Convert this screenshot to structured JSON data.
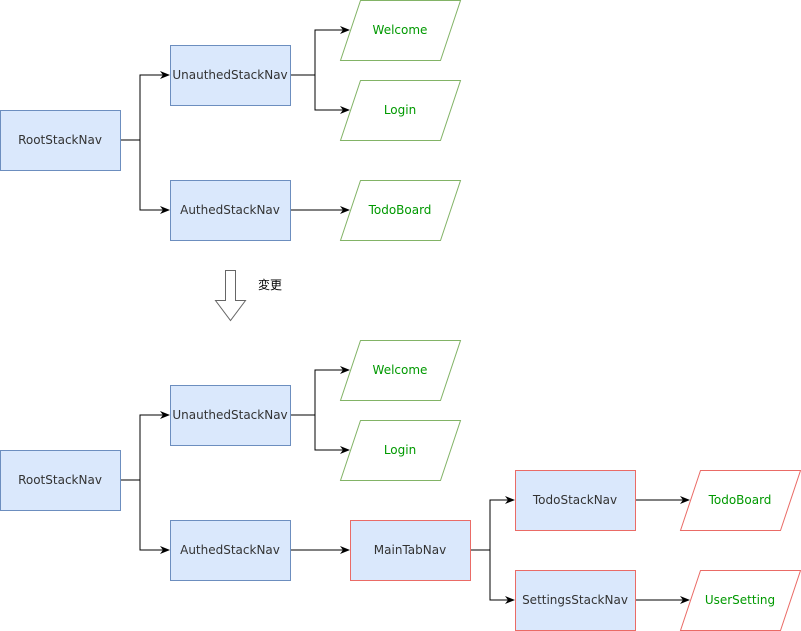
{
  "diagram": {
    "before": {
      "nodes": {
        "root": "RootStackNav",
        "unauthed": "UnauthedStackNav",
        "authed": "AuthedStackNav",
        "welcome": "Welcome",
        "login": "Login",
        "todoboard": "TodoBoard"
      },
      "edges": [
        [
          "RootStackNav",
          "UnauthedStackNav"
        ],
        [
          "RootStackNav",
          "AuthedStackNav"
        ],
        [
          "UnauthedStackNav",
          "Welcome"
        ],
        [
          "UnauthedStackNav",
          "Login"
        ],
        [
          "AuthedStackNav",
          "TodoBoard"
        ]
      ]
    },
    "transition_label": "変更",
    "after": {
      "nodes": {
        "root": "RootStackNav",
        "unauthed": "UnauthedStackNav",
        "authed": "AuthedStackNav",
        "welcome": "Welcome",
        "login": "Login",
        "maintab": "MainTabNav",
        "todostack": "TodoStackNav",
        "settingsstack": "SettingsStackNav",
        "todoboard": "TodoBoard",
        "usersetting": "UserSetting"
      },
      "edges": [
        [
          "RootStackNav",
          "UnauthedStackNav"
        ],
        [
          "RootStackNav",
          "AuthedStackNav"
        ],
        [
          "UnauthedStackNav",
          "Welcome"
        ],
        [
          "UnauthedStackNav",
          "Login"
        ],
        [
          "AuthedStackNav",
          "MainTabNav"
        ],
        [
          "MainTabNav",
          "TodoStackNav"
        ],
        [
          "MainTabNav",
          "SettingsStackNav"
        ],
        [
          "TodoStackNav",
          "TodoBoard"
        ],
        [
          "SettingsStackNav",
          "UserSetting"
        ]
      ],
      "highlight_color": "#ea6b66"
    },
    "colors": {
      "box_fill": "#dae8fc",
      "box_stroke": "#6c8ebf",
      "screen_stroke": "#82b366",
      "screen_text": "#009900",
      "new_stroke": "#ea6b66"
    }
  }
}
